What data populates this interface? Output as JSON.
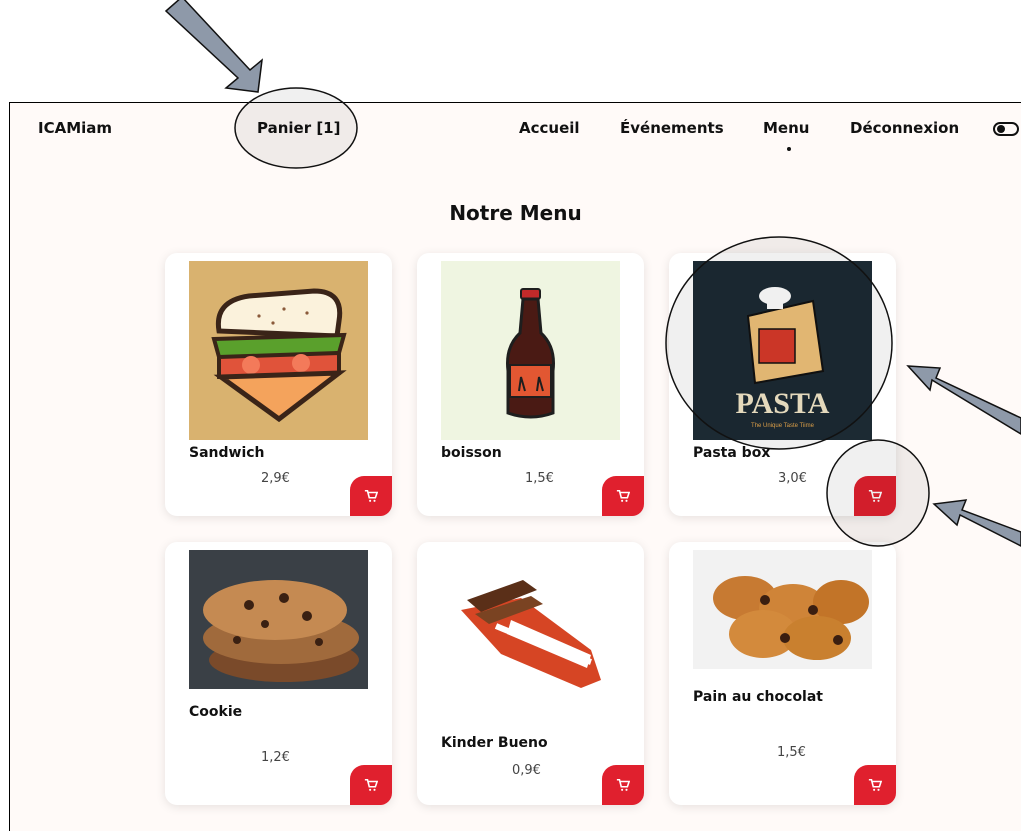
{
  "nav": {
    "brand": "ICAMiam",
    "cart": "Panier [1]",
    "items": [
      "Accueil",
      "Événements",
      "Menu",
      "Déconnexion"
    ]
  },
  "page": {
    "title": "Notre Menu"
  },
  "products": [
    {
      "name": "Sandwich",
      "price": "2,9€"
    },
    {
      "name": "boisson",
      "price": "1,5€"
    },
    {
      "name": "Pasta box",
      "price": "3,0€"
    },
    {
      "name": "Cookie",
      "price": "1,2€"
    },
    {
      "name": "Kinder Bueno",
      "price": "0,9€"
    },
    {
      "name": "Pain au chocolat",
      "price": "1,5€"
    }
  ],
  "pasta_box_image_text": {
    "headline": "PASTA",
    "tagline": "The Unique Taste Tiime"
  },
  "colors": {
    "accent": "#e0202e",
    "page_bg": "#fffaf8",
    "annotation_arrow": "#8e99a9"
  }
}
